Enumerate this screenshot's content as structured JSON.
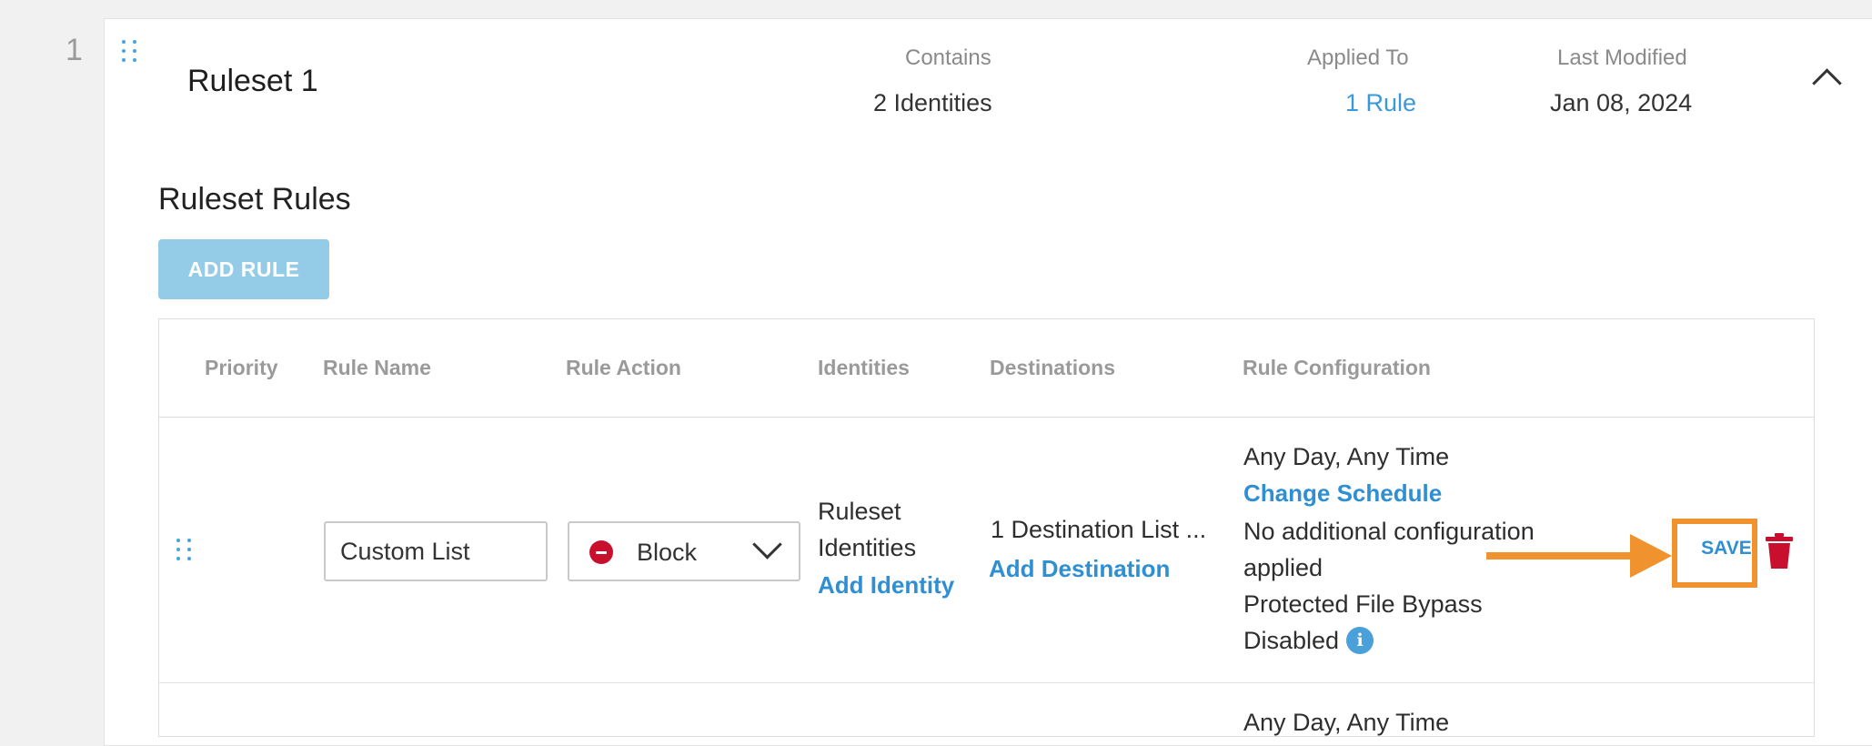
{
  "ruleset": {
    "index": "1",
    "name": "Ruleset 1",
    "contains_label": "Contains",
    "contains_value": "2 Identities",
    "applied_label": "Applied To",
    "applied_value": "1 Rule",
    "modified_label": "Last Modified",
    "modified_value": "Jan 08, 2024"
  },
  "rules_section": {
    "title": "Ruleset Rules",
    "add_rule_label": "ADD RULE"
  },
  "table": {
    "headers": [
      "Priority",
      "Rule Name",
      "Rule Action",
      "Identities",
      "Destinations",
      "Rule Configuration"
    ],
    "row": {
      "rule_name": "Custom List",
      "action": "Block",
      "identities_line1": "Ruleset",
      "identities_line2": "Identities",
      "add_identity": "Add Identity",
      "destinations": "1 Destination List ...",
      "add_destination": "Add Destination",
      "schedule": "Any Day, Any Time",
      "change_schedule": "Change Schedule",
      "config_line1": "No additional configuration",
      "config_line2": "applied",
      "bypass_line1": "Protected File Bypass",
      "bypass_line2": "Disabled",
      "info_icon": "i",
      "save_label": "SAVE"
    },
    "next_row": {
      "schedule": "Any Day, Any Time"
    }
  },
  "icons": {
    "drag_handle": "drag-handle-icon",
    "collapse": "chevron-up-icon",
    "block": "block-icon",
    "dropdown": "chevron-down-icon",
    "info": "info-icon",
    "delete": "trash-icon"
  },
  "colors": {
    "link": "#2f8fd3",
    "add_rule_bg": "#94cbe7",
    "block": "#c8102e",
    "annotation": "#f0922e",
    "trash": "#c8102e"
  }
}
